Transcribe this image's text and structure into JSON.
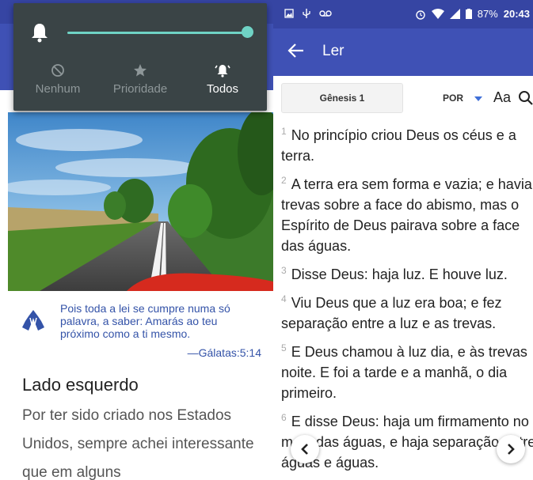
{
  "left": {
    "quick_panel": {
      "modes": [
        {
          "label": "Nenhum",
          "icon": "block-icon",
          "active": false
        },
        {
          "label": "Prioridade",
          "icon": "star-icon",
          "active": false
        },
        {
          "label": "Todos",
          "icon": "bell-ringing-icon",
          "active": true
        }
      ],
      "volume_fraction": 1.0,
      "accent": "#6fd3c5"
    },
    "verse": {
      "text": "Pois toda a lei se cumpre numa só palavra, a saber: Amarás ao teu próximo como a ti mesmo.",
      "reference": "—Gálatas:5:14"
    },
    "article": {
      "title": "Lado esquerdo",
      "body": "Por ter sido criado nos Estados Unidos, sempre achei interessante que em alguns"
    }
  },
  "right": {
    "status_bar": {
      "battery": "87%",
      "time": "20:43"
    },
    "appbar": {
      "title": "Ler"
    },
    "toolbar": {
      "book": "Gênesis 1",
      "language": "POR",
      "font_size_label": "Aa"
    },
    "verses": [
      {
        "num": "1",
        "text": "No princípio criou Deus os céus e a terra."
      },
      {
        "num": "2",
        "text": "A terra era sem forma e vazia; e havia trevas sobre a face do abismo, mas o Espírito de Deus pairava sobre a face das águas."
      },
      {
        "num": "3",
        "text": "Disse Deus: haja luz. E houve luz."
      },
      {
        "num": "4",
        "text": "Viu Deus que a luz era boa; e fez separação entre a luz e as trevas."
      },
      {
        "num": "5",
        "text": "E Deus chamou à luz dia, e às trevas noite. E foi a tarde e a manhã, o dia primeiro."
      },
      {
        "num": "6",
        "text": "E disse Deus: haja um firmamento no meio das águas, e haja separação entre águas e águas."
      }
    ]
  },
  "colors": {
    "primary": "#3f51b5",
    "status": "#3645a3",
    "verse_blue": "#3453a8"
  }
}
